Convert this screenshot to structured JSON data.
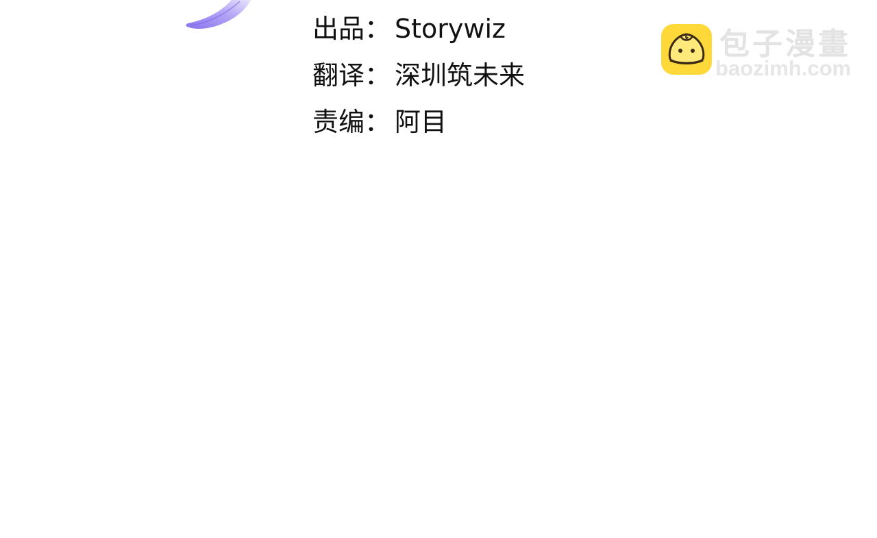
{
  "credits": [
    {
      "label": "出品：",
      "value": "Storywiz"
    },
    {
      "label": "翻译：",
      "value": "深圳筑未来"
    },
    {
      "label": "责编：",
      "value": "阿目"
    }
  ],
  "watermark": {
    "title": "包子漫畫",
    "url": "baozimh.com",
    "logo_icon": "steamed-bun-icon",
    "logo_color": "#ffd83a",
    "text_color": "#e3e3e3"
  },
  "decoration": {
    "icon": "purple-feather-icon",
    "color": "#9f8cf2"
  }
}
